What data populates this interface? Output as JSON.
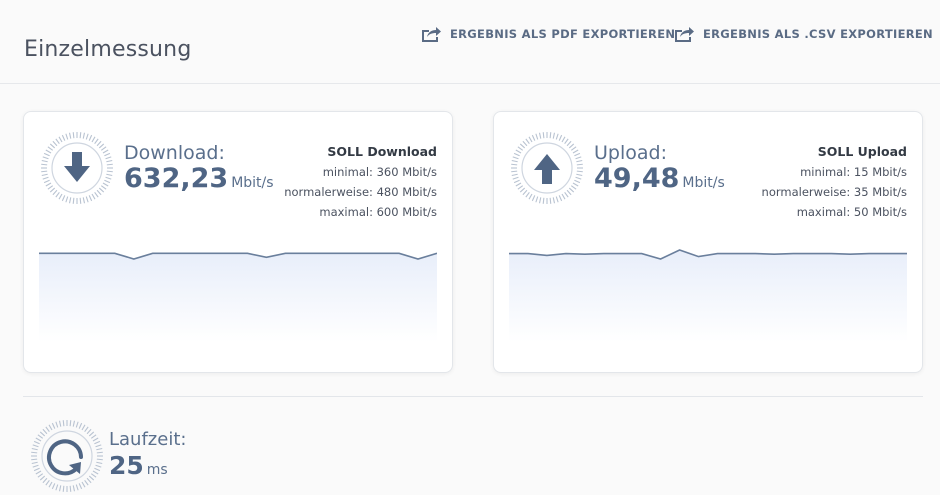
{
  "header": {
    "title": "Einzelmessung",
    "export_pdf_label": "ERGEBNIS ALS PDF EXPORTIEREN",
    "export_csv_label": "ERGEBNIS ALS .CSV EXPORTIEREN"
  },
  "download": {
    "label": "Download:",
    "value": "632,23",
    "unit": "Mbit/s",
    "icon": "arrow-down-icon",
    "soll": {
      "title": "SOLL Download",
      "minimal": "minimal: 360 Mbit/s",
      "normal": "normalerweise: 480 Mbit/s",
      "maximal": "maximal: 600 Mbit/s"
    },
    "series": [
      632,
      632,
      632,
      632,
      632,
      612,
      632,
      632,
      632,
      632,
      632,
      632,
      618,
      632,
      632,
      632,
      632,
      632,
      632,
      632,
      612,
      632
    ]
  },
  "upload": {
    "label": "Upload:",
    "value": "49,48",
    "unit": "Mbit/s",
    "icon": "arrow-up-icon",
    "soll": {
      "title": "SOLL Upload",
      "minimal": "minimal: 15 Mbit/s",
      "normal": "normalerweise: 35 Mbit/s",
      "maximal": "maximal: 50 Mbit/s"
    },
    "series": [
      49.5,
      49.5,
      49.2,
      49.5,
      49.4,
      49.5,
      49.5,
      49.5,
      48.6,
      50.1,
      49.0,
      49.5,
      49.5,
      49.5,
      49.4,
      49.5,
      49.5,
      49.5,
      49.4,
      49.5,
      49.5,
      49.5
    ]
  },
  "latency": {
    "label": "Laufzeit:",
    "value": "25",
    "unit": "ms",
    "icon": "refresh-icon"
  },
  "colors": {
    "accent": "#4f6584",
    "line": "#6a7f9c",
    "fill": "#eef3fb"
  }
}
